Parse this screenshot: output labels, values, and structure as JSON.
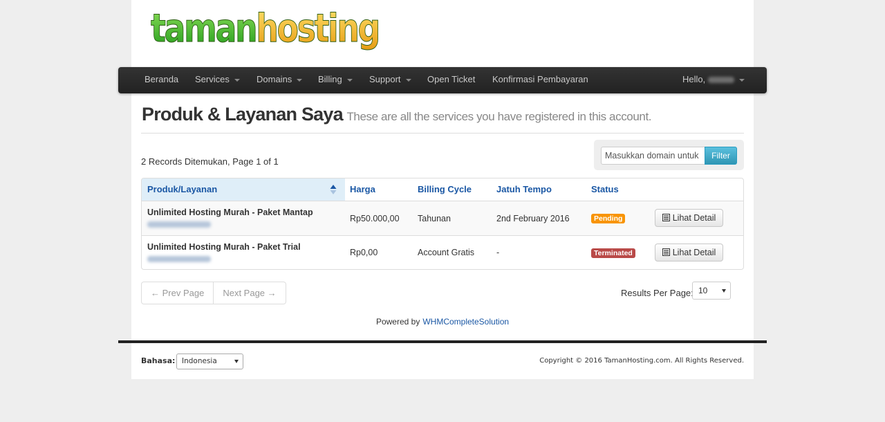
{
  "logo": {
    "part1": "taman",
    "part2": "hosting",
    "color1": "#3cb82a",
    "color2": "#f5b21a"
  },
  "nav": {
    "items": [
      {
        "label": "Beranda",
        "dropdown": false
      },
      {
        "label": "Services",
        "dropdown": true
      },
      {
        "label": "Domains",
        "dropdown": true
      },
      {
        "label": "Billing",
        "dropdown": true
      },
      {
        "label": "Support",
        "dropdown": true
      },
      {
        "label": "Open Ticket",
        "dropdown": false
      },
      {
        "label": "Konfirmasi Pembayaran",
        "dropdown": false
      }
    ],
    "user_greeting": "Hello,"
  },
  "header": {
    "title": "Produk & Layanan Saya",
    "subtitle": "These are all the services you have registered in this account."
  },
  "records_text": "2 Records Ditemukan, Page 1 of 1",
  "search": {
    "placeholder": "Masukkan domain untuk m",
    "button_label": "Filter"
  },
  "table": {
    "columns": [
      "Produk/Layanan",
      "Harga",
      "Billing Cycle",
      "Jatuh Tempo",
      "Status",
      ""
    ],
    "rows": [
      {
        "product": "Unlimited Hosting Murah - Paket Mantap",
        "price": "Rp50.000,00",
        "cycle": "Tahunan",
        "due": "2nd February 2016",
        "status": "Pending",
        "status_color": "#f89406",
        "action": "Lihat Detail"
      },
      {
        "product": "Unlimited Hosting Murah - Paket Trial",
        "price": "Rp0,00",
        "cycle": "Account Gratis",
        "due": "-",
        "status": "Terminated",
        "status_color": "#b94a48",
        "action": "Lihat Detail"
      }
    ]
  },
  "pager": {
    "prev": "← Prev Page",
    "next": "Next Page →"
  },
  "results_per_page": {
    "label": "Results Per Page:",
    "value": "10"
  },
  "powered": {
    "prefix": "Powered by",
    "link": "WHMCompleteSolution"
  },
  "footer": {
    "language_label": "Bahasa:",
    "language_value": "Indonesia",
    "copyright": "Copyright © 2016 TamanHosting.com. All Rights Reserved."
  }
}
